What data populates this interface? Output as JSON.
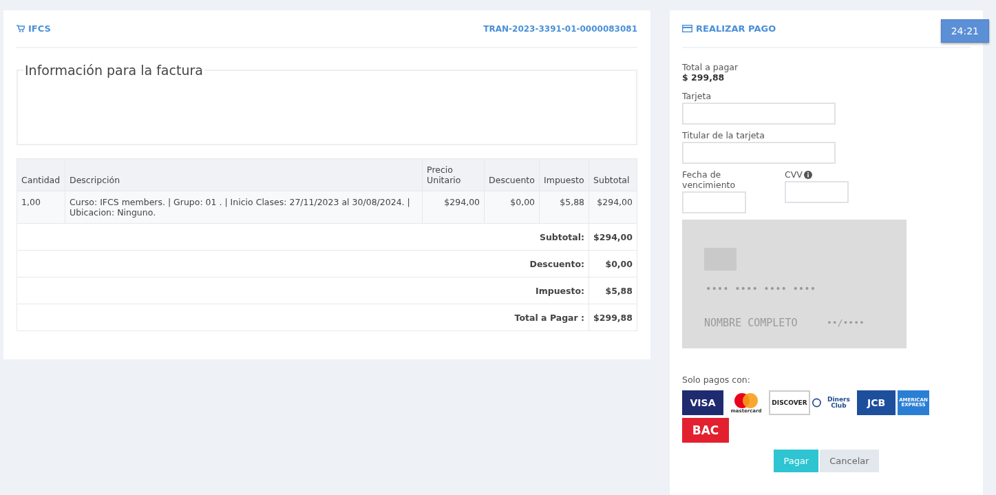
{
  "invoice": {
    "brand": "IFCS",
    "transaction": "TRAN-2023-3391-01-0000083081",
    "fieldset_legend": "Información para la factura",
    "table": {
      "columns": [
        "Cantidad",
        "Descripción",
        "Precio Unitario",
        "Descuento",
        "Impuesto",
        "Subtotal"
      ],
      "rows": [
        {
          "cells": [
            "1,00",
            "Curso: IFCS members. | Grupo: 01 . | Inicio Clases: 27/11/2023 al 30/08/2024. | Ubicacion: Ninguno.",
            "$294,00",
            "$0,00",
            "$5,88",
            "$294,00"
          ]
        }
      ],
      "totals": [
        {
          "label": "Subtotal:",
          "value": "$294,00"
        },
        {
          "label": "Descuento:",
          "value": "$0,00"
        },
        {
          "label": "Impuesto:",
          "value": "$5,88"
        },
        {
          "label": "Total a Pagar :",
          "value": "$299,88"
        }
      ]
    }
  },
  "payment": {
    "title": "REALIZAR PAGO",
    "timer": "24:21",
    "total_label": "Total a pagar",
    "total_value": "$ 299,88",
    "fields": [
      {
        "label": "Tarjeta"
      },
      {
        "label": "Titular de la tarjeta"
      }
    ],
    "expiry_label": "Fecha de vencimiento",
    "cvv_label": "CVV",
    "card_preview": {
      "number": "•••• •••• •••• ••••",
      "name": "NOMBRE COMPLETO",
      "expiry": "••/••••"
    },
    "accepted_label": "Solo pagos con:",
    "brands": [
      {
        "kind": "visa",
        "text": "VISA"
      },
      {
        "kind": "mastercard",
        "text": "mastercard"
      },
      {
        "kind": "discover",
        "text": "DISCOVER"
      },
      {
        "kind": "diners",
        "text": "Diners Club"
      },
      {
        "kind": "jcb",
        "text": "JCB"
      },
      {
        "kind": "amex",
        "text": "AMERICAN EXPRESS"
      },
      {
        "kind": "bac",
        "text": "BAC"
      }
    ],
    "buttons": [
      {
        "kind": "primary",
        "label": "Pagar"
      },
      {
        "kind": "secondary",
        "label": "Cancelar"
      }
    ]
  }
}
